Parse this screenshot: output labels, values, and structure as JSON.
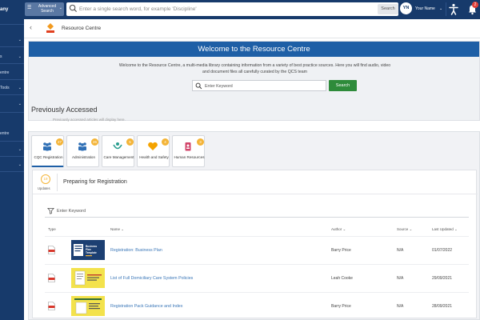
{
  "sidebar": {
    "brand_fragment": "any",
    "items": [
      {
        "label": "",
        "has_chevron": true
      },
      {
        "label": "s",
        "has_chevron": true
      },
      {
        "label": "entre",
        "has_chevron": false
      },
      {
        "label": "Tools",
        "has_chevron": true
      },
      {
        "label": "",
        "has_chevron": true
      },
      {
        "label": "entre",
        "has_chevron": false
      },
      {
        "label": "",
        "has_chevron": true
      },
      {
        "label": "",
        "has_chevron": true
      }
    ]
  },
  "topbar": {
    "advanced_search_label": "Advanced Search",
    "search_placeholder": "Enter a single search word, for example 'Discipline'",
    "search_button": "Search",
    "user_initials": "YN",
    "user_name": "Your Name",
    "notification_count": "2"
  },
  "header": {
    "title": "Resource Centre"
  },
  "banner": {
    "heading": "Welcome to the Resource Centre",
    "description": "Welcome to the Resource Centre, a multi-media library containing information from a variety of best practice sources. Here you will find audio, video and document files all carefully curated by the QCS team",
    "search_placeholder": "Enter Keyword",
    "search_button": "Search"
  },
  "previously_accessed": {
    "title": "Previously Accessed",
    "subtitle": "Previously accessed articles will display here."
  },
  "tabs": [
    {
      "label": "CQC Registration",
      "count": "27",
      "icon": "people-icon",
      "color": "#2f6fb5"
    },
    {
      "label": "Administration",
      "count": "26",
      "icon": "people-icon",
      "color": "#2f6fb5"
    },
    {
      "label": "Care Management",
      "count": "5",
      "icon": "care-icon",
      "color": "#2a9d8f"
    },
    {
      "label": "Health and Safety",
      "count": "4",
      "icon": "heart-icon",
      "color": "#f4a300"
    },
    {
      "label": "Human Resources",
      "count": "3",
      "icon": "id-badge-icon",
      "color": "#d2456a"
    }
  ],
  "category": {
    "updates_count": "19",
    "updates_label": "Updates",
    "title": "Preparing for Registration",
    "filter_placeholder": "Enter Keyword",
    "columns": {
      "type": "Type",
      "name": "Name",
      "author": "Author",
      "source": "Source",
      "last_updated": "Last Updated"
    },
    "rows": [
      {
        "name": "Registration: Business Plan",
        "author": "Barry Price",
        "source": "N/A",
        "date": "01/07/2022",
        "thumb_text": "Business Plan Template"
      },
      {
        "name": "List of Full Domiciliary Care System Policies",
        "author": "Leah Cooke",
        "source": "N/A",
        "date": "29/09/2021",
        "thumb_text": ""
      },
      {
        "name": "Registration Pack Guidance and Index",
        "author": "Barry Price",
        "source": "N/A",
        "date": "28/09/2021",
        "thumb_text": ""
      }
    ]
  },
  "colors": {
    "nav_bg": "#173a6b",
    "banner_blue": "#1e5fa6",
    "search_green": "#2e8b3a",
    "badge_orange": "#f4b437",
    "link_blue": "#3b77b8"
  }
}
